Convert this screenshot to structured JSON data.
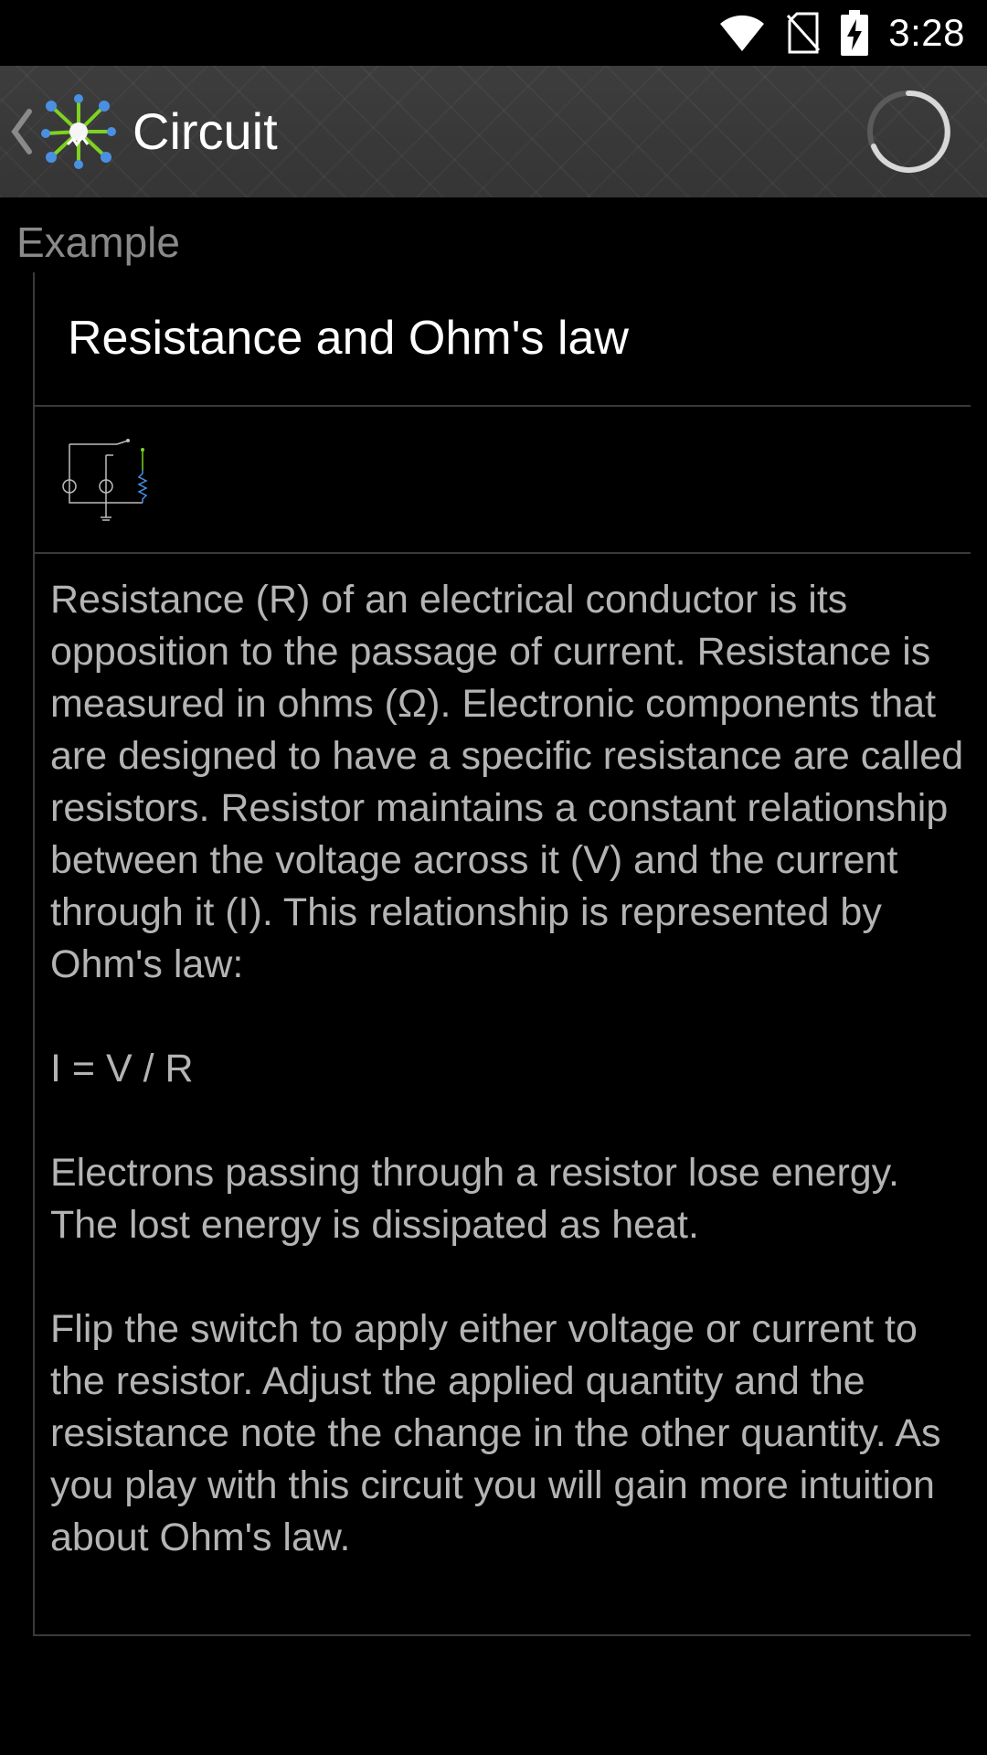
{
  "status_bar": {
    "time": "3:28",
    "icons": [
      "wifi-icon",
      "no-sim-icon",
      "battery-charging-icon"
    ]
  },
  "app_bar": {
    "title": "Circuit",
    "icons": [
      "back-chevron-icon",
      "circuit-logo-icon",
      "loading-spinner-icon"
    ]
  },
  "section": {
    "header": "Example"
  },
  "example": {
    "title": "Resistance and Ohm's law",
    "description": [
      "Resistance (R) of an electrical conductor is its opposition to the passage of current. Resistance is measured in ohms (Ω). Electronic components that are designed to have a specific resistance are called resistors. Resistor maintains a constant relationship between the voltage across it (V) and the current through it (I). This relationship is represented by Ohm's law:",
      "I = V / R",
      "Electrons passing through a resistor lose energy. The lost energy is dissipated as heat.",
      "Flip the switch to apply either voltage or current to the resistor. Adjust the applied quantity and the resistance note the change in the other quantity. As you play with this circuit you will gain more intuition about Ohm's law."
    ]
  },
  "colors": {
    "background": "#000000",
    "app_bar": "#3a3a3a",
    "header_text": "#8a8a8a",
    "body_text": "#b4b4b4",
    "divider": "#3a3a3a"
  }
}
